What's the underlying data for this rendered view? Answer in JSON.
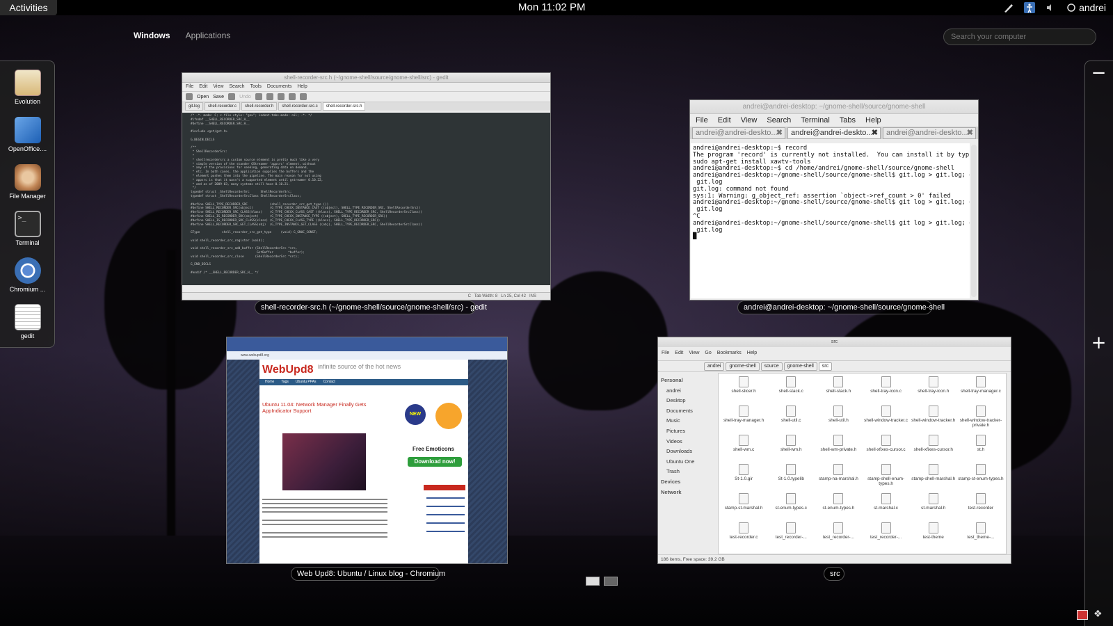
{
  "top_panel": {
    "activities": "Activities",
    "clock": "Mon 11:02 PM",
    "user": "andrei"
  },
  "view_tabs": {
    "windows": "Windows",
    "applications": "Applications"
  },
  "search": {
    "placeholder": "Search your computer"
  },
  "dash": [
    {
      "label": "Evolution",
      "icon": "evolution-icon"
    },
    {
      "label": "OpenOffice....",
      "icon": "openoffice-icon"
    },
    {
      "label": "File Manager",
      "icon": "file-manager-icon"
    },
    {
      "label": "Terminal",
      "icon": "terminal-icon"
    },
    {
      "label": "Chromium ...",
      "icon": "chromium-icon"
    },
    {
      "label": "gedit",
      "icon": "gedit-icon"
    }
  ],
  "workspace_controls": {
    "remove": "−",
    "add": "+"
  },
  "gedit": {
    "caption": "shell-recorder-src.h (~/gnome-shell/source/gnome-shell/src) - gedit",
    "title": "shell-recorder-src.h (~/gnome-shell/source/gnome-shell/src) - gedit",
    "menu": [
      "File",
      "Edit",
      "View",
      "Search",
      "Tools",
      "Documents",
      "Help"
    ],
    "toolbar": [
      "Open",
      "Save",
      "Undo"
    ],
    "tabs": [
      "git.log",
      "shell-recorder.c",
      "shell-recorder.h",
      "shell-recorder-src.c",
      "shell-recorder-src.h"
    ],
    "code": "/* -*- mode: C; c-file-style: \"gnu\"; indent-tabs-mode: nil; -*- */\n#ifndef __SHELL_RECORDER_SRC_H__\n#define __SHELL_RECORDER_SRC_H__\n\n#include <gst/gst.h>\n\nG_BEGIN_DECLS\n\n/**\n * ShellRecorderSrc:\n *\n * shellrecordersrc a custom source element is pretty much like a very\n * simple version of the stander GStreamer 'appsrc' element, without\n * any of the provisions for seeking, generating data on demand,\n * etc. In both cases, the application supplies the buffers and the\n * element pushes them into the pipeline. The main reason for not using\n * appsrc is that it wasn't a supported element until gstreamer 0.10.22,\n * and as of 2009-03, many systems still have 0.10.21.\n */\ntypedef struct _ShellRecorderSrc      ShellRecorderSrc;\ntypedef struct _ShellRecorderSrcClass ShellRecorderSrcClass;\n\n#define SHELL_TYPE_RECORDER_SRC            (shell_recorder_src_get_type ())\n#define SHELL_RECORDER_SRC(object)         (G_TYPE_CHECK_INSTANCE_CAST ((object), SHELL_TYPE_RECORDER_SRC, ShellRecorderSrc))\n#define SHELL_RECORDER_SRC_CLASS(klass)    (G_TYPE_CHECK_CLASS_CAST ((klass), SHELL_TYPE_RECORDER_SRC, ShellRecorderSrcClass))\n#define SHELL_IS_RECORDER_SRC(object)      (G_TYPE_CHECK_INSTANCE_TYPE ((object), SHELL_TYPE_RECORDER_SRC))\n#define SHELL_IS_RECORDER_SRC_CLASS(klass) (G_TYPE_CHECK_CLASS_TYPE ((klass), SHELL_TYPE_RECORDER_SRC))\n#define SHELL_RECORDER_SRC_GET_CLASS(obj)  (G_TYPE_INSTANCE_GET_CLASS ((obj), SHELL_TYPE_RECORDER_SRC, ShellRecorderSrcClass))\n\nGType            shell_recorder_src_get_type     (void) G_GNUC_CONST;\n\nvoid shell_recorder_src_register (void);\n\nvoid shell_recorder_src_add_buffer (ShellRecorderSrc *src,\n                                    GstBuffer        *buffer);\nvoid shell_recorder_src_close      (ShellRecorderSrc *src);\n\nG_END_DECLS\n\n#endif /* __SHELL_RECORDER_SRC_H__ */",
    "status": [
      "C",
      "Tab Width: 8",
      "Ln 25, Col 42",
      "INS"
    ]
  },
  "terminal": {
    "caption": "andrei@andrei-desktop: ~/gnome-shell/source/gnome-shell",
    "title": "andrei@andrei-desktop: ~/gnome-shell/source/gnome-shell",
    "menu": [
      "File",
      "Edit",
      "View",
      "Search",
      "Terminal",
      "Tabs",
      "Help"
    ],
    "tabs": [
      "andrei@andrei-deskto...",
      "andrei@andrei-deskto...",
      "andrei@andrei-deskto..."
    ],
    "body": "andrei@andrei-desktop:~$ record\nThe program 'record' is currently not installed.  You can install it by typing:\nsudo apt-get install xawtv-tools\nandrei@andrei-desktop:~$ cd /home/andrei/gnome-shell/source/gnome-shell\nandrei@andrei-desktop:~/gnome-shell/source/gnome-shell$ git.log > git.log; gedit\n git.log\ngit.log: command not found\nsys:1: Warning: g_object_ref: assertion `object->ref_count > 0' failed\nandrei@andrei-desktop:~/gnome-shell/source/gnome-shell$ git log > git.log; gedit\n git.log\n^C\nandrei@andrei-desktop:~/gnome-shell/source/gnome-shell$ git log > git.log; gedit\n git.log\n█"
  },
  "chromium": {
    "caption": "Web Upd8: Ubuntu / Linux blog - Chromium",
    "url": "www.webupd8.org",
    "logo": "WebUpd8",
    "tagline": "infinite source of the hot news",
    "nav": [
      "Home",
      "Tags",
      "Ubuntu PPAs",
      "Contact"
    ],
    "headline": "Ubuntu 11.04: Network Manager Finally Gets AppIndicator Support",
    "ad_title": "Free Emoticons",
    "ad_button": "Download now!",
    "new_badge": "NEW"
  },
  "nautilus": {
    "caption": "src",
    "title": "src",
    "menu": [
      "File",
      "Edit",
      "View",
      "Go",
      "Bookmarks",
      "Help"
    ],
    "path": [
      "andrei",
      "gnome-shell",
      "source",
      "gnome-shell",
      "src"
    ],
    "sidebar": {
      "personal": "Personal",
      "items": [
        "andrei",
        "Desktop",
        "Documents",
        "Music",
        "Pictures",
        "Videos",
        "Downloads",
        "Ubuntu One",
        "Trash"
      ],
      "devices": "Devices",
      "network": "Network"
    },
    "files": [
      "shell-slicer.h",
      "shell-stack.c",
      "shell-stack.h",
      "shell-tray-icon.c",
      "shell-tray-icon.h",
      "shell-tray-manager.c",
      "shell-tray-manager.h",
      "shell-util.c",
      "shell-util.h",
      "shell-window-tracker.c",
      "shell-window-tracker.h",
      "shell-window-tracker-private.h",
      "shell-wm.c",
      "shell-wm.h",
      "shell-wm-private.h",
      "shell-xfixes-cursor.c",
      "shell-xfixes-cursor.h",
      "st.h",
      "St-1.0.gir",
      "St-1.0.typelib",
      "stamp-na-marshal.h",
      "stamp-shell-enum-types.h",
      "stamp-shell-marshal.h",
      "stamp-st-enum-types.h",
      "stamp-st-marshal.h",
      "st-enum-types.c",
      "st-enum-types.h",
      "st-marshal.c",
      "st-marshal.h",
      "test-recorder",
      "test-recorder.c",
      "test_recorder-...",
      "test_recorder-...",
      "test_recorder-...",
      "test-theme",
      "test_theme-..."
    ],
    "status": "186 items, Free space: 39.2 GB"
  }
}
